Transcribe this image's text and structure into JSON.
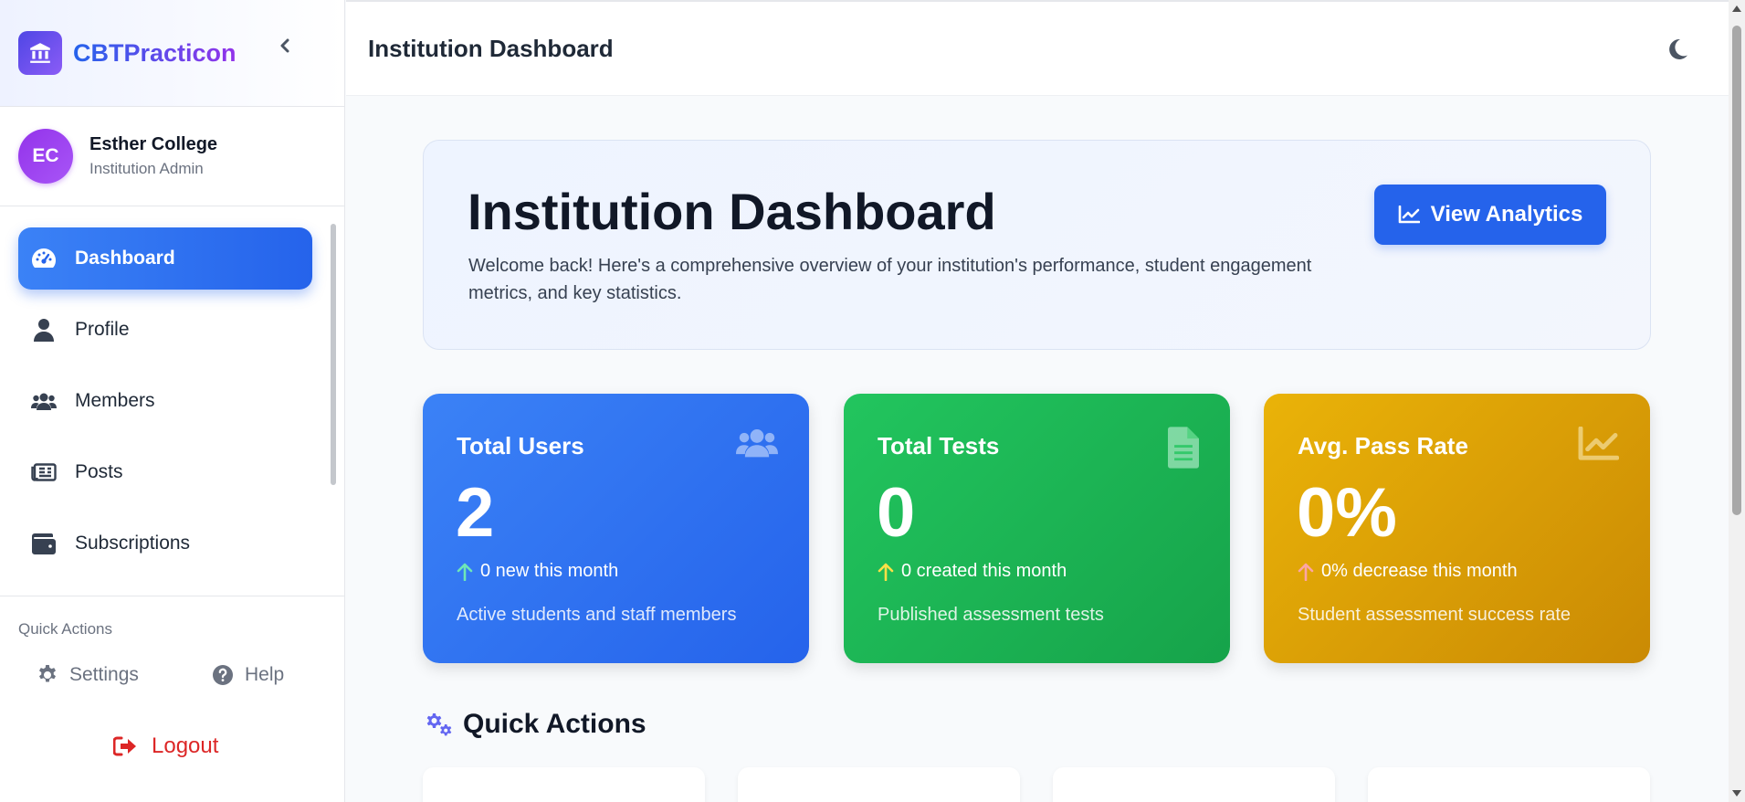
{
  "app": {
    "name": "CBTPracticon"
  },
  "user": {
    "initials": "EC",
    "name": "Esther College",
    "role": "Institution Admin"
  },
  "sidebar": {
    "items": [
      {
        "label": "Dashboard",
        "icon": "gauge-icon",
        "active": true
      },
      {
        "label": "Profile",
        "icon": "user-icon"
      },
      {
        "label": "Members",
        "icon": "users-icon"
      },
      {
        "label": "Posts",
        "icon": "newspaper-icon"
      },
      {
        "label": "Subscriptions",
        "icon": "wallet-icon"
      }
    ],
    "quick_actions_title": "Quick Actions",
    "settings_label": "Settings",
    "help_label": "Help",
    "logout_label": "Logout"
  },
  "header": {
    "title": "Institution Dashboard"
  },
  "hero": {
    "title": "Institution Dashboard",
    "subtitle": "Welcome back! Here's a comprehensive overview of your institution's performance, student engagement metrics, and key statistics.",
    "button_label": "View Analytics"
  },
  "stats": [
    {
      "title": "Total Users",
      "value": "2",
      "change": "0 new this month",
      "description": "Active students and staff members",
      "color": "#2563eb",
      "arrow_color": "#6ee7b7",
      "icon": "users-icon"
    },
    {
      "title": "Total Tests",
      "value": "0",
      "change": "0 created this month",
      "description": "Published assessment tests",
      "color": "#16a34a",
      "arrow_color": "#fde047",
      "icon": "document-icon"
    },
    {
      "title": "Avg. Pass Rate",
      "value": "0%",
      "change": "0% decrease this month",
      "description": "Student assessment success rate",
      "color": "#ca8a04",
      "arrow_color": "#fca5a5",
      "icon": "chart-line-icon"
    }
  ],
  "quick_actions": {
    "title": "Quick Actions"
  },
  "colors": {
    "primary": "#2563eb",
    "brand_gradient_start": "#2563eb",
    "brand_gradient_end": "#9333ea",
    "logout": "#dc2626"
  }
}
